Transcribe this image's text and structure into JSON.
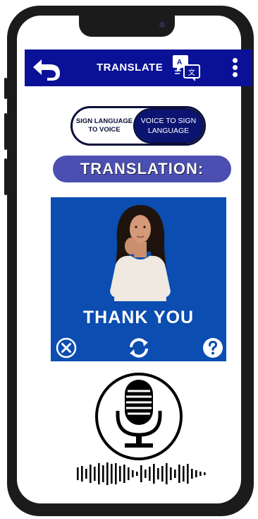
{
  "header": {
    "title": "TRANSLATE",
    "back_icon": "back-arrow-icon",
    "translate_icon": "translate-icon",
    "menu_icon": "more-vertical-icon",
    "color": "#0a1196"
  },
  "toggle": {
    "left_label": "SIGN LANGUAGE TO VOICE",
    "right_label": "VOICE TO SIGN LANGUAGE",
    "selected": "right"
  },
  "translation_label": "TRANSLATION:",
  "panel": {
    "caption": "THANK YOU",
    "close_icon": "close-circle-icon",
    "refresh_icon": "refresh-icon",
    "help_icon": "help-circle-icon",
    "background": "#0b4db0"
  },
  "controls": {
    "mic_icon": "microphone-icon",
    "waveform_icon": "audio-waveform-icon"
  }
}
